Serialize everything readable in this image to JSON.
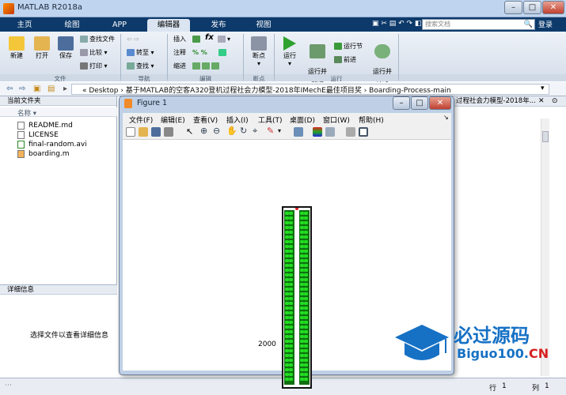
{
  "window": {
    "title": "MATLAB R2018a"
  },
  "tabs": [
    {
      "label": "主页"
    },
    {
      "label": "绘图"
    },
    {
      "label": "APP"
    },
    {
      "label": "编辑器"
    },
    {
      "label": "发布"
    },
    {
      "label": "视图"
    }
  ],
  "search": {
    "placeholder": "搜索文档"
  },
  "login_label": "登录",
  "toolstrip": {
    "file": {
      "new": "新建",
      "open": "打开",
      "save": "保存",
      "find_files": "查找文件",
      "compare": "比较",
      "print": "打印",
      "group": "文件"
    },
    "navigate": {
      "goto": "转至",
      "find": "查找",
      "group": "导航"
    },
    "edit": {
      "insert": "插入",
      "comment": "注释",
      "indent": "缩进",
      "fx": "fx",
      "group": "编辑"
    },
    "breakpoints": {
      "label": "断点",
      "group": "断点"
    },
    "run": {
      "run": "运行",
      "run_advance": "运行并\n前进",
      "run_section": "运行节",
      "advance": "前进",
      "run_time": "运行并\n计时",
      "group": "运行"
    }
  },
  "address": {
    "path": "« Desktop › 基于MATLAB的空客A320登机过程社会力模型-2018年IMechE最佳项目奖 › Boarding-Process-main"
  },
  "current_folder": {
    "header": "当前文件夹",
    "column": "名称 ▾",
    "files": [
      {
        "name": "README.md"
      },
      {
        "name": "LICENSE"
      },
      {
        "name": "final-random.avi"
      },
      {
        "name": "boarding.m"
      }
    ]
  },
  "details": {
    "header": "详细信息",
    "message": "选择文件以查看详细信息"
  },
  "command_header": "过程社会力模型-2018年...",
  "figure": {
    "title": "Figure 1",
    "menu": [
      "文件(F)",
      "编辑(E)",
      "查看(V)",
      "插入(I)",
      "工具(T)",
      "桌面(D)",
      "窗口(W)",
      "帮助(H)"
    ],
    "label": "2000"
  },
  "status": {
    "row_label": "行",
    "row": "1",
    "col_label": "列",
    "col": "1"
  },
  "watermark": {
    "line1": "必过源码",
    "line2a": "Biguo100.",
    "line2b": "CN"
  },
  "colors": {
    "accent": "#0d3a6b",
    "seat": "#22dd22",
    "brand": "#1671c5"
  }
}
